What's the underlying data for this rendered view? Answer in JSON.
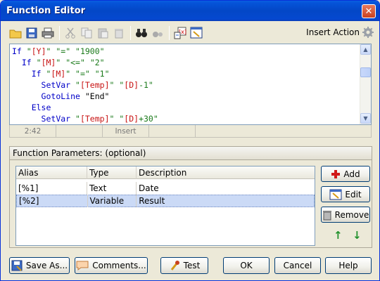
{
  "window": {
    "title": "Function Editor",
    "close_glyph": "✕"
  },
  "toolbar": {
    "icons": [
      "new-folder-icon",
      "save-icon",
      "print-icon",
      "cut-icon",
      "copy-icon",
      "paste-icon",
      "delete-icon",
      "find-icon",
      "find-replace-icon",
      "insert-variable-icon",
      "insert-action-icon"
    ],
    "insert_action_label": "Insert Action",
    "gear_icon": "gear-icon"
  },
  "editor": {
    "lines": [
      [
        [
          "kw",
          "If "
        ],
        [
          "st",
          "\""
        ],
        [
          "vr",
          "[Y]"
        ],
        [
          "st",
          "\" \"=\" \"1900\""
        ]
      ],
      [
        [
          "pl",
          "  "
        ],
        [
          "kw",
          "If "
        ],
        [
          "st",
          "\""
        ],
        [
          "vr",
          "[M]"
        ],
        [
          "st",
          "\" \"<=\" \"2\""
        ]
      ],
      [
        [
          "pl",
          "    "
        ],
        [
          "kw",
          "If "
        ],
        [
          "st",
          "\""
        ],
        [
          "vr",
          "[M]"
        ],
        [
          "st",
          "\" \"=\" \"1\""
        ]
      ],
      [
        [
          "pl",
          "      "
        ],
        [
          "kw",
          "SetVar "
        ],
        [
          "st",
          "\""
        ],
        [
          "vr",
          "[Temp]"
        ],
        [
          "st",
          "\" \""
        ],
        [
          "vr",
          "[D]"
        ],
        [
          "st",
          "-1\""
        ]
      ],
      [
        [
          "pl",
          "      "
        ],
        [
          "kw",
          "GotoLine "
        ],
        [
          "pl",
          "\"End\""
        ]
      ],
      [
        [
          "pl",
          "    "
        ],
        [
          "kw",
          "Else"
        ]
      ],
      [
        [
          "pl",
          "      "
        ],
        [
          "kw",
          "SetVar "
        ],
        [
          "st",
          "\""
        ],
        [
          "vr",
          "[Temp]"
        ],
        [
          "st",
          "\" \""
        ],
        [
          "vr",
          "[D]"
        ],
        [
          "st",
          "+30\""
        ]
      ]
    ]
  },
  "status": {
    "position": "2:42",
    "field2": "",
    "mode": "Insert",
    "field4": ""
  },
  "params": {
    "header": "Function Parameters: (optional)",
    "columns": [
      "Alias",
      "Type",
      "Description"
    ],
    "rows": [
      {
        "alias": "[%1]",
        "type": "Text",
        "description": "Date"
      },
      {
        "alias": "[%2]",
        "type": "Variable",
        "description": "Result"
      }
    ],
    "buttons": {
      "add": "Add",
      "edit": "Edit",
      "remove": "Remove"
    }
  },
  "bottom": {
    "save_as": "Save As...",
    "comments": "Comments...",
    "test": "Test",
    "ok": "OK",
    "cancel": "Cancel",
    "help": "Help"
  }
}
